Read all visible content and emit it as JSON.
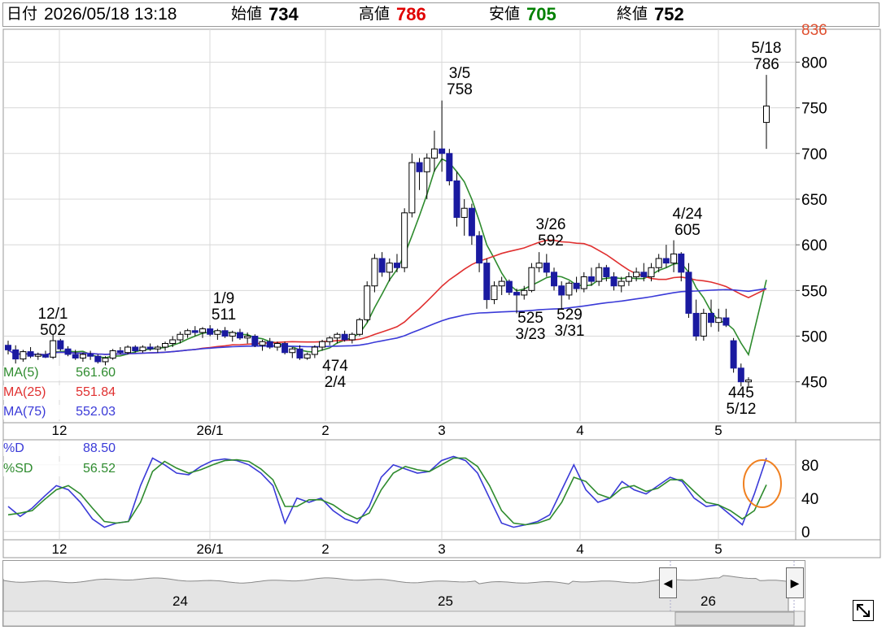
{
  "header": {
    "date_label": "日付",
    "date_value": "2026/05/18 13:18",
    "open_label": "始値",
    "open_value": "734",
    "high_label": "高値",
    "high_value": "786",
    "low_label": "安値",
    "low_value": "705",
    "close_label": "終値",
    "close_value": "752",
    "colors": {
      "high": "#e00000",
      "low": "#008000"
    }
  },
  "legend_main": [
    {
      "name": "MA(5)",
      "value": "561.60",
      "color": "#2e8b2e"
    },
    {
      "name": "MA(25)",
      "value": "551.84",
      "color": "#e03030"
    },
    {
      "name": "MA(75)",
      "value": "552.03",
      "color": "#3a3ad8"
    }
  ],
  "legend_sub": [
    {
      "name": "%D",
      "value": "88.50",
      "color": "#3a3ad8"
    },
    {
      "name": "%SD",
      "value": "56.52",
      "color": "#2e8b2e"
    }
  ],
  "navigator": {
    "labels": [
      "24",
      "25",
      "26"
    ],
    "left_arrow": "◀",
    "right_arrow": "▶"
  },
  "chart_data": [
    {
      "type": "candlestick",
      "y_ticks": [
        "836",
        "800",
        "750",
        "700",
        "650",
        "600",
        "550",
        "500",
        "450"
      ],
      "x_ticks": [
        "12",
        "26/1",
        "2",
        "3",
        "4",
        "5"
      ],
      "ylim": [
        407,
        836
      ],
      "grid": true,
      "annotations": [
        {
          "date": "12/1",
          "value": "502"
        },
        {
          "date": "1/9",
          "value": "511"
        },
        {
          "date": "2/4",
          "value": "474"
        },
        {
          "date": "3/5",
          "value": "758"
        },
        {
          "date": "3/23",
          "value": "525"
        },
        {
          "date": "3/26",
          "value": "592"
        },
        {
          "date": "3/31",
          "value": "529"
        },
        {
          "date": "4/24",
          "value": "605"
        },
        {
          "date": "5/12",
          "value": "445"
        },
        {
          "date": "5/18",
          "value": "786"
        }
      ],
      "candles": [
        [
          490,
          495,
          480,
          485
        ],
        [
          485,
          490,
          470,
          475
        ],
        [
          475,
          485,
          472,
          483
        ],
        [
          483,
          488,
          476,
          478
        ],
        [
          478,
          482,
          474,
          480
        ],
        [
          480,
          484,
          476,
          477
        ],
        [
          477,
          502,
          475,
          495
        ],
        [
          495,
          497,
          484,
          486
        ],
        [
          486,
          489,
          478,
          480
        ],
        [
          480,
          485,
          474,
          476
        ],
        [
          476,
          482,
          472,
          480
        ],
        [
          480,
          484,
          474,
          478
        ],
        [
          478,
          480,
          470,
          472
        ],
        [
          472,
          478,
          468,
          476
        ],
        [
          476,
          486,
          474,
          484
        ],
        [
          484,
          488,
          480,
          482
        ],
        [
          482,
          490,
          480,
          488
        ],
        [
          488,
          490,
          482,
          484
        ],
        [
          484,
          490,
          482,
          488
        ],
        [
          488,
          492,
          484,
          486
        ],
        [
          486,
          490,
          482,
          488
        ],
        [
          488,
          494,
          484,
          492
        ],
        [
          492,
          500,
          488,
          496
        ],
        [
          496,
          505,
          492,
          502
        ],
        [
          502,
          508,
          498,
          506
        ],
        [
          506,
          511,
          500,
          504
        ],
        [
          504,
          510,
          498,
          508
        ],
        [
          508,
          512,
          500,
          502
        ],
        [
          502,
          508,
          496,
          506
        ],
        [
          506,
          510,
          498,
          500
        ],
        [
          500,
          506,
          494,
          504
        ],
        [
          504,
          508,
          496,
          498
        ],
        [
          498,
          504,
          492,
          500
        ],
        [
          500,
          502,
          488,
          490
        ],
        [
          490,
          496,
          484,
          494
        ],
        [
          494,
          498,
          486,
          488
        ],
        [
          488,
          494,
          484,
          492
        ],
        [
          492,
          494,
          480,
          482
        ],
        [
          482,
          488,
          476,
          486
        ],
        [
          486,
          490,
          474,
          476
        ],
        [
          476,
          482,
          474,
          480
        ],
        [
          480,
          490,
          476,
          488
        ],
        [
          488,
          496,
          484,
          494
        ],
        [
          494,
          500,
          490,
          498
        ],
        [
          498,
          504,
          492,
          502
        ],
        [
          502,
          506,
          494,
          496
        ],
        [
          496,
          504,
          492,
          502
        ],
        [
          502,
          520,
          500,
          518
        ],
        [
          518,
          560,
          515,
          555
        ],
        [
          555,
          590,
          548,
          585
        ],
        [
          585,
          592,
          565,
          570
        ],
        [
          570,
          585,
          560,
          580
        ],
        [
          580,
          590,
          570,
          575
        ],
        [
          575,
          640,
          570,
          635
        ],
        [
          635,
          700,
          630,
          690
        ],
        [
          690,
          695,
          660,
          680
        ],
        [
          680,
          700,
          650,
          695
        ],
        [
          695,
          725,
          680,
          705
        ],
        [
          705,
          758,
          680,
          700
        ],
        [
          700,
          705,
          665,
          670
        ],
        [
          670,
          680,
          620,
          630
        ],
        [
          630,
          650,
          610,
          640
        ],
        [
          640,
          645,
          600,
          610
        ],
        [
          610,
          615,
          570,
          580
        ],
        [
          580,
          585,
          530,
          540
        ],
        [
          540,
          560,
          535,
          555
        ],
        [
          555,
          565,
          545,
          560
        ],
        [
          560,
          562,
          545,
          548
        ],
        [
          548,
          552,
          525,
          545
        ],
        [
          545,
          555,
          540,
          550
        ],
        [
          550,
          580,
          548,
          575
        ],
        [
          575,
          592,
          570,
          580
        ],
        [
          580,
          590,
          565,
          570
        ],
        [
          570,
          575,
          550,
          555
        ],
        [
          555,
          560,
          529,
          545
        ],
        [
          545,
          560,
          540,
          558
        ],
        [
          558,
          565,
          548,
          552
        ],
        [
          552,
          570,
          548,
          565
        ],
        [
          565,
          575,
          555,
          560
        ],
        [
          560,
          580,
          555,
          575
        ],
        [
          575,
          578,
          560,
          565
        ],
        [
          565,
          570,
          550,
          555
        ],
        [
          555,
          565,
          548,
          560
        ],
        [
          560,
          570,
          555,
          565
        ],
        [
          565,
          575,
          560,
          570
        ],
        [
          570,
          580,
          560,
          565
        ],
        [
          565,
          580,
          560,
          575
        ],
        [
          575,
          590,
          570,
          585
        ],
        [
          585,
          600,
          575,
          580
        ],
        [
          580,
          605,
          570,
          590
        ],
        [
          590,
          592,
          560,
          570
        ],
        [
          570,
          580,
          520,
          525
        ],
        [
          525,
          540,
          495,
          500
        ],
        [
          500,
          530,
          495,
          525
        ],
        [
          525,
          540,
          510,
          515
        ],
        [
          515,
          530,
          505,
          520
        ],
        [
          520,
          530,
          510,
          512
        ],
        [
          495,
          498,
          460,
          465
        ],
        [
          465,
          470,
          445,
          450
        ],
        [
          450,
          455,
          445,
          452
        ],
        [
          734,
          786,
          705,
          752
        ]
      ]
    },
    {
      "type": "line",
      "y_ticks": [
        "80",
        "40",
        "0"
      ],
      "x_ticks": [
        "12",
        "26/1",
        "2",
        "3",
        "4",
        "5"
      ],
      "ylim": [
        -10,
        110
      ],
      "grid": true,
      "series": [
        {
          "name": "%D",
          "color": "#3a3ad8",
          "values": [
            30,
            18,
            28,
            42,
            55,
            50,
            35,
            15,
            5,
            10,
            12,
            55,
            88,
            80,
            70,
            68,
            78,
            85,
            87,
            85,
            80,
            70,
            55,
            10,
            40,
            35,
            40,
            25,
            15,
            10,
            30,
            65,
            80,
            75,
            70,
            72,
            85,
            90,
            85,
            70,
            40,
            10,
            5,
            8,
            12,
            20,
            50,
            80,
            50,
            35,
            40,
            60,
            50,
            45,
            55,
            65,
            60,
            40,
            30,
            32,
            20,
            8,
            45,
            88
          ]
        },
        {
          "name": "%SD",
          "color": "#2e8b2e",
          "values": [
            20,
            22,
            25,
            38,
            50,
            55,
            45,
            28,
            12,
            10,
            12,
            35,
            72,
            84,
            76,
            70,
            74,
            80,
            85,
            86,
            84,
            75,
            62,
            30,
            30,
            38,
            38,
            32,
            22,
            15,
            22,
            50,
            70,
            78,
            74,
            72,
            80,
            88,
            88,
            78,
            55,
            25,
            10,
            8,
            10,
            15,
            35,
            65,
            60,
            45,
            40,
            52,
            55,
            48,
            52,
            62,
            62,
            48,
            35,
            32,
            25,
            15,
            25,
            56
          ]
        }
      ]
    }
  ]
}
